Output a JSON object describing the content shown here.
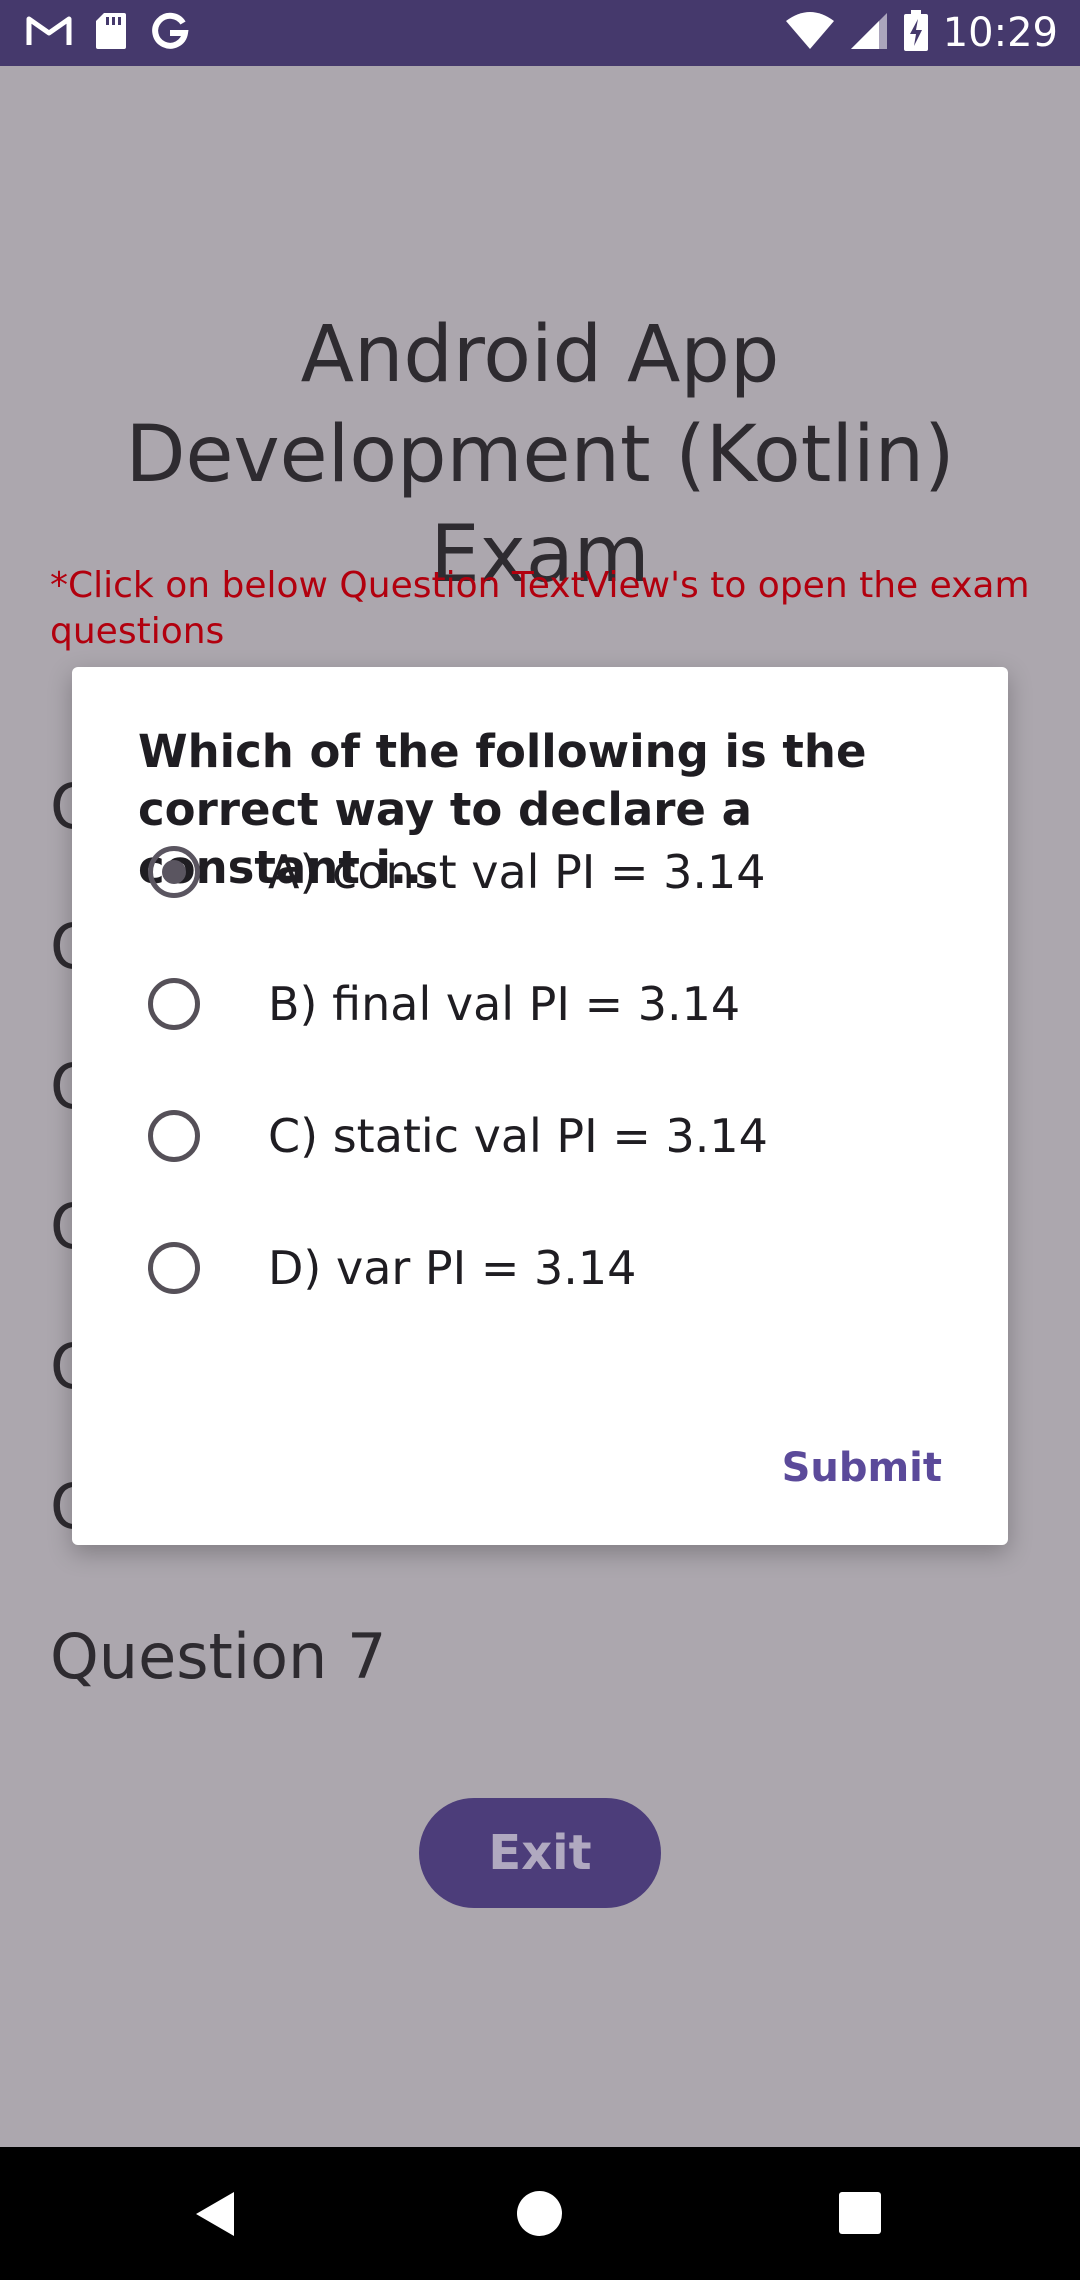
{
  "status_bar": {
    "time": "10:29",
    "left_icons": [
      "gmail-icon",
      "sd-card-icon",
      "google-icon"
    ],
    "right_icons": [
      "wifi-icon",
      "cellular-signal-icon",
      "battery-charging-icon"
    ]
  },
  "screen": {
    "title": "Android App Development (Kotlin) Exam",
    "hint": "*Click on below Question TextView's to open the exam questions",
    "questions": [
      "Q",
      "Q",
      "Q",
      "Q",
      "Q",
      "Q",
      "Question 7"
    ],
    "exit_label": "Exit"
  },
  "dialog": {
    "question": "Which of the following is the\ncorrect way to declare a constant i…",
    "options": [
      {
        "label": "A) const val PI = 3.14",
        "selected": true
      },
      {
        "label": "B) final val PI = 3.14",
        "selected": false
      },
      {
        "label": "C) static val PI = 3.14",
        "selected": false
      },
      {
        "label": "D) var PI = 3.14",
        "selected": false
      }
    ],
    "submit_label": "Submit"
  },
  "nav_bar": {
    "icons": [
      "back-icon",
      "home-icon",
      "recents-icon"
    ]
  },
  "colors": {
    "status_bar": "#45396c",
    "accent": "#5b4a9a",
    "hint_text": "#b2000e",
    "scrim_background": "#aca7ae"
  }
}
